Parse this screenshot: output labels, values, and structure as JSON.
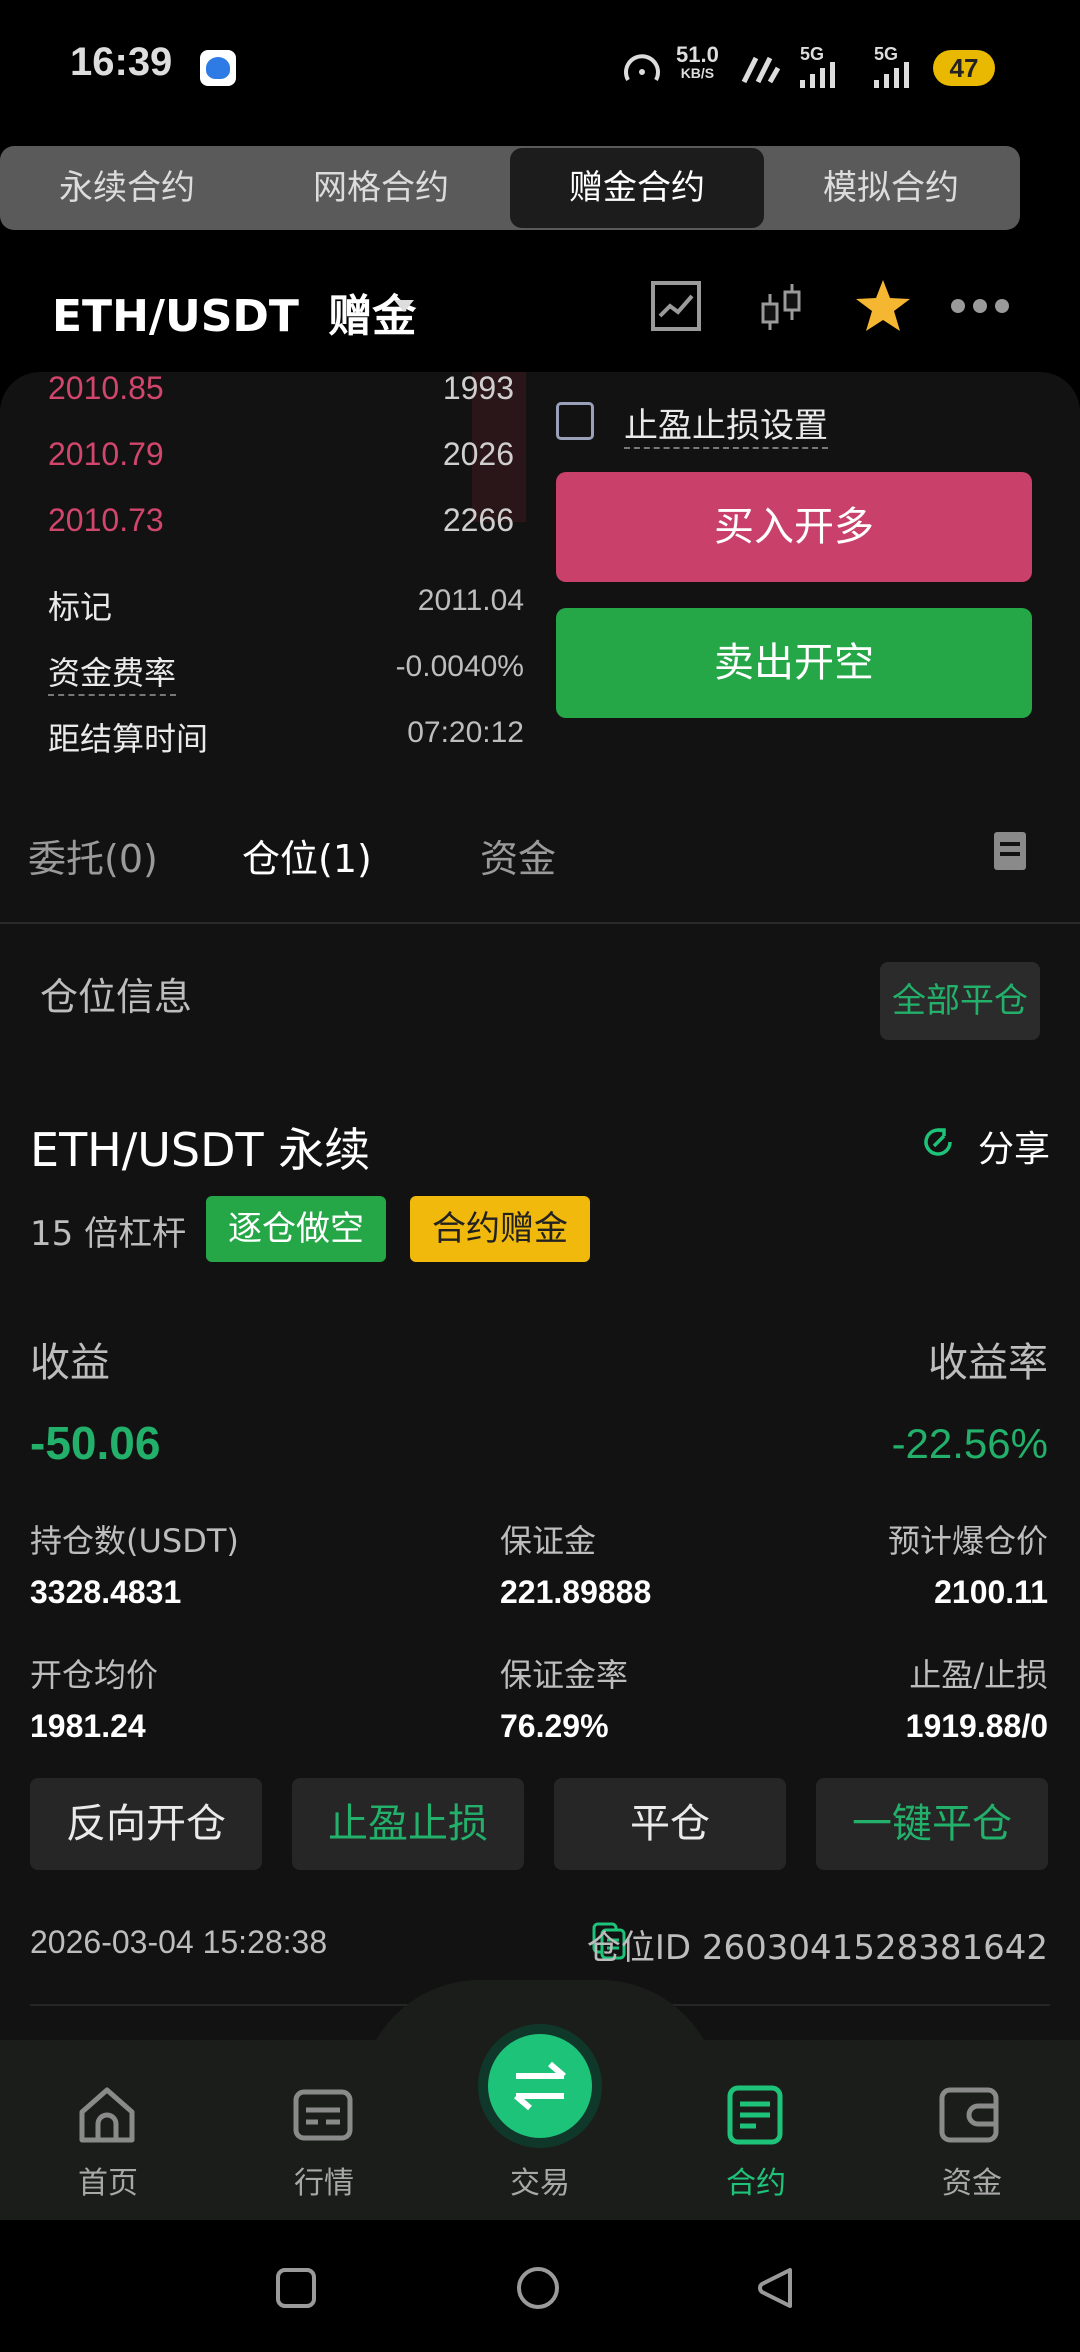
{
  "status_bar": {
    "time": "16:39",
    "net_speed": "51.0",
    "net_unit": "KB/S",
    "signal1": "5G",
    "signal2": "5G",
    "battery": "47"
  },
  "segments": [
    {
      "label": "永续合约",
      "active": false
    },
    {
      "label": "网格合约",
      "active": false
    },
    {
      "label": "赠金合约",
      "active": true
    },
    {
      "label": "模拟合约",
      "active": false
    }
  ],
  "header": {
    "pair": "ETH/USDT",
    "mode": "赠金"
  },
  "order_book": {
    "asks": [
      {
        "price": "2010.85",
        "qty": "1993"
      },
      {
        "price": "2010.79",
        "qty": "2026"
      },
      {
        "price": "2010.73",
        "qty": "2266"
      }
    ]
  },
  "market_info": {
    "mark_label": "标记",
    "mark_value": "2011.04",
    "funding_label": "资金费率",
    "funding_value": "-0.0040%",
    "settle_label": "距结算时间",
    "settle_value": "07:20:12"
  },
  "order_form": {
    "tpsl_label": "止盈止损设置",
    "buy_label": "买入开多",
    "sell_label": "卖出开空"
  },
  "tabs": {
    "orders": "委托(0)",
    "positions": "仓位(1)",
    "assets": "资金"
  },
  "positions_section": {
    "title": "仓位信息",
    "close_all": "全部平仓"
  },
  "position": {
    "title": "ETH/USDT 永续",
    "share": "分享",
    "leverage": "15 倍杠杆",
    "tag_mode": "逐仓做空",
    "tag_bonus": "合约赠金",
    "pnl_label": "收益",
    "pnl_value": "-50.06",
    "roe_label": "收益率",
    "roe_value": "-22.56%",
    "size_label": "持仓数(USDT)",
    "size_value": "3328.4831",
    "margin_label": "保证金",
    "margin_value": "221.89888",
    "liq_label": "预计爆仓价",
    "liq_value": "2100.11",
    "entry_label": "开仓均价",
    "entry_value": "1981.24",
    "margin_ratio_label": "保证金率",
    "margin_ratio_value": "76.29%",
    "tpsl_label": "止盈/止损",
    "tpsl_value": "1919.88/0",
    "btn_reverse": "反向开仓",
    "btn_tpsl": "止盈止损",
    "btn_close": "平仓",
    "btn_close_all": "一键平仓",
    "opened_at": "2026-03-04 15:28:38",
    "position_id": "仓位ID 2603041528381642"
  },
  "bottom_nav": [
    {
      "label": "首页",
      "icon": "home-icon",
      "active": false
    },
    {
      "label": "行情",
      "icon": "market-icon",
      "active": false
    },
    {
      "label": "交易",
      "icon": "swap-icon",
      "active": false
    },
    {
      "label": "合约",
      "icon": "contract-icon",
      "active": true
    },
    {
      "label": "资金",
      "icon": "wallet-icon",
      "active": false
    }
  ],
  "colors": {
    "up_green": "#25a748",
    "down_red": "#c9406a",
    "accent_green": "#1ec37a",
    "bonus_yellow": "#f0b90b"
  }
}
